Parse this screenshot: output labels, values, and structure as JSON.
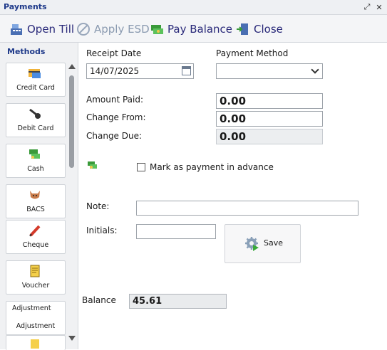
{
  "window": {
    "title": "Payments",
    "restore_label": "⤢",
    "close_label": "✕"
  },
  "toolbar": {
    "open_till": "Open Till",
    "apply_esd": "Apply ESD",
    "pay_balance": "Pay Balance",
    "close": "Close"
  },
  "sidebar": {
    "title": "Methods",
    "items": [
      {
        "label": "Credit Card"
      },
      {
        "label": "Debit Card"
      },
      {
        "label": "Cash"
      },
      {
        "label": "BACS"
      },
      {
        "label": "Cheque"
      },
      {
        "label": "Voucher"
      },
      {
        "label": "Adjustment",
        "alt": "Adjustment"
      }
    ]
  },
  "form": {
    "receipt_date_label": "Receipt Date",
    "receipt_date_value": "14/07/2025",
    "payment_method_label": "Payment Method",
    "payment_method_value": "",
    "amount_paid_label": "Amount Paid:",
    "amount_paid_value": "0.00",
    "change_from_label": "Change From:",
    "change_from_value": "0.00",
    "change_due_label": "Change Due:",
    "change_due_value": "0.00",
    "advance_label": "Mark as payment in advance",
    "advance_checked": false,
    "note_label": "Note:",
    "note_value": "",
    "initials_label": "Initials:",
    "initials_value": "",
    "save_label": "Save",
    "balance_label": "Balance",
    "balance_value": "45.61"
  }
}
